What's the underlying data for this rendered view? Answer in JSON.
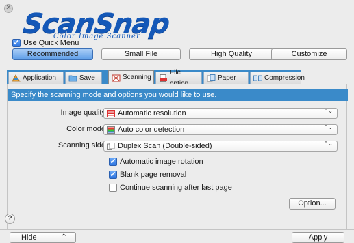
{
  "window": {
    "close_glyph": "✕",
    "app_logo": "ScanSnap",
    "app_logo_tagline": "Color Image Scanner"
  },
  "quick_menu": {
    "label": "Use Quick Menu",
    "checked": true
  },
  "modes": [
    {
      "label": "Recommended",
      "active": true
    },
    {
      "label": "Small File",
      "active": false
    },
    {
      "label": "High Quality",
      "active": false
    },
    {
      "label": "Customize",
      "active": false
    }
  ],
  "tabs": [
    {
      "label": "Application",
      "icon": "application-icon",
      "active": false
    },
    {
      "label": "Save",
      "icon": "save-folder-icon",
      "active": false
    },
    {
      "label": "Scanning",
      "icon": "scanning-icon",
      "active": true
    },
    {
      "label": "File option",
      "icon": "file-option-icon",
      "active": false
    },
    {
      "label": "Paper",
      "icon": "paper-icon",
      "active": false
    },
    {
      "label": "Compression",
      "icon": "compression-icon",
      "active": false
    }
  ],
  "scanning": {
    "banner": "Specify the scanning mode and options you would like to use.",
    "image_quality": {
      "label": "Image quality:",
      "value": "Automatic resolution",
      "icon": "resolution-icon"
    },
    "color_mode": {
      "label": "Color mode:",
      "value": "Auto color detection",
      "icon": "color-detection-icon"
    },
    "scanning_side": {
      "label": "Scanning side:",
      "value": "Duplex Scan (Double-sided)",
      "icon": "duplex-icon"
    },
    "options": [
      {
        "label": "Automatic image rotation",
        "checked": true
      },
      {
        "label": "Blank page removal",
        "checked": true
      },
      {
        "label": "Continue scanning after last page",
        "checked": false
      }
    ],
    "option_button": "Option...",
    "select_arrows": "⌃⌄"
  },
  "footer": {
    "help": "?",
    "hide": "Hide",
    "hide_caret": "^",
    "apply": "Apply"
  },
  "colors": {
    "accent_blue": "#3a8ac9",
    "logo_blue": "#1458b8",
    "active_mode": "#5f9ee8"
  }
}
